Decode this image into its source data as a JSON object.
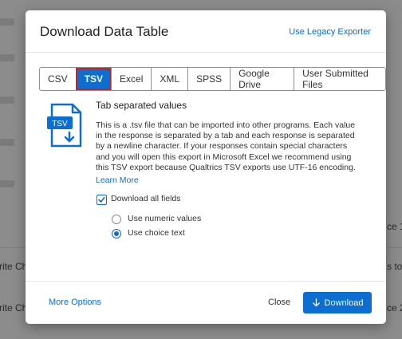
{
  "background": {
    "snippets": [
      "rite Ch",
      "rite Ch",
      "ce 1",
      "s to w",
      "ce 2"
    ]
  },
  "dialog": {
    "title": "Download Data Table",
    "legacy_link": "Use Legacy Exporter",
    "tabs": [
      "CSV",
      "TSV",
      "Excel",
      "XML",
      "SPSS",
      "Google Drive",
      "User Submitted Files"
    ],
    "active_tab": "TSV",
    "file_icon_label": "TSV",
    "format_title": "Tab separated values",
    "description": "This is a .tsv file that can be imported into other programs. Each value in the response is separated by a tab and each response is separated by a newline character. If your responses contain special characters and you will open this export in Microsoft Excel we recommend using this TSV export because Qualtrics TSV exports use UTF-16 encoding.",
    "learn_more": "Learn More",
    "download_all_fields": {
      "label": "Download all fields",
      "checked": true
    },
    "value_options": [
      {
        "label": "Use numeric values",
        "selected": false
      },
      {
        "label": "Use choice text",
        "selected": true
      }
    ],
    "footer": {
      "more_options": "More Options",
      "close": "Close",
      "download": "Download"
    }
  },
  "colors": {
    "accent": "#0b6ed0",
    "active_tab_outline": "#c0272d",
    "overlay": "#8c8c8c"
  }
}
